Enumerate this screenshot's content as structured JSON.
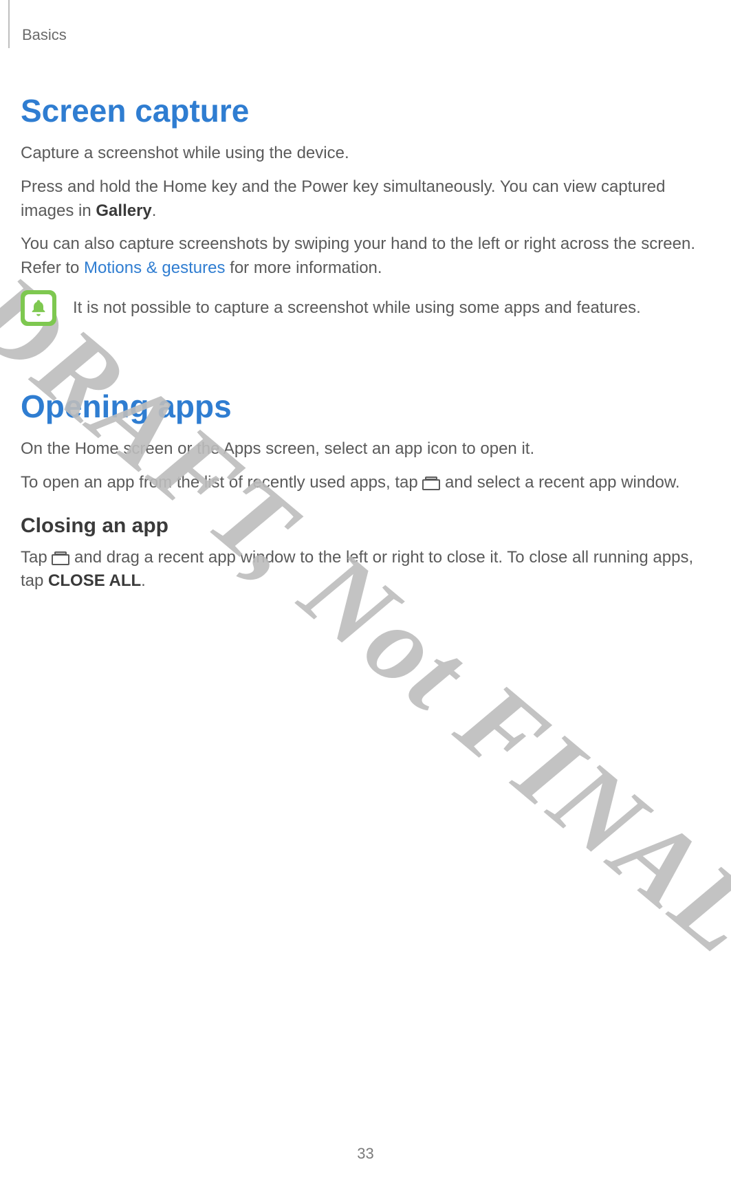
{
  "breadcrumb": "Basics",
  "watermark": "DRAFT, Not FINAL",
  "page_number": "33",
  "section1": {
    "heading": "Screen capture",
    "p1": "Capture a screenshot while using the device.",
    "p2_a": "Press and hold the Home key and the Power key simultaneously. You can view captured images in ",
    "p2_bold": "Gallery",
    "p2_b": ".",
    "p3_a": "You can also capture screenshots by swiping your hand to the left or right across the screen. Refer to ",
    "p3_link": "Motions & gestures",
    "p3_b": " for more information.",
    "note": "It is not possible to capture a screenshot while using some apps and features."
  },
  "section2": {
    "heading": "Opening apps",
    "p1": "On the Home screen or the Apps screen, select an app icon to open it.",
    "p2_a": "To open an app from the list of recently used apps, tap ",
    "p2_b": " and select a recent app window.",
    "sub_heading": "Closing an app",
    "p3_a": "Tap ",
    "p3_b": " and drag a recent app window to the left or right to close it. To close all running apps, tap ",
    "p3_bold": "CLOSE ALL",
    "p3_c": "."
  }
}
